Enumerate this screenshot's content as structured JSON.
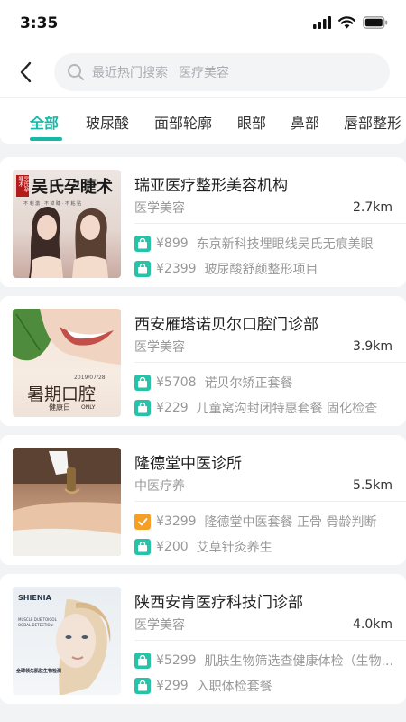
{
  "status_bar": {
    "time": "3:35"
  },
  "search": {
    "placeholder_label": "最近热门搜索",
    "placeholder_term": "医疗美容"
  },
  "tabs": [
    {
      "label": "全部",
      "active": true
    },
    {
      "label": "玻尿酸",
      "active": false
    },
    {
      "label": "面部轮廓",
      "active": false
    },
    {
      "label": "眼部",
      "active": false
    },
    {
      "label": "鼻部",
      "active": false
    },
    {
      "label": "唇部整形",
      "active": false
    }
  ],
  "accent_color": "#18b8a6",
  "clinics": [
    {
      "name": "瑞亚医疗整形美容机构",
      "category": "医学美容",
      "distance": "2.7km",
      "thumb_text": {
        "main": "吴氏孕睫术",
        "tag": "吴氏孕睫术",
        "sub": "不 刺 激 · 不 掉 睫 · 不 粘 贴"
      },
      "deals": [
        {
          "price": "¥899",
          "title": "东京新科技埋眼线吴氏无痕美眼",
          "icon": "shopping-bag-icon"
        },
        {
          "price": "¥2399",
          "title": "玻尿酸舒颜整形项目",
          "icon": "shopping-bag-icon"
        }
      ]
    },
    {
      "name": "西安雁塔诺贝尔口腔门诊部",
      "category": "医学美容",
      "distance": "3.9km",
      "thumb_text": {
        "date": "2019/07/28",
        "main": "暑期口腔",
        "sub": "健康日",
        "tag": "ONLY"
      },
      "deals": [
        {
          "price": "¥5708",
          "title": "诺贝尔矫正套餐",
          "icon": "shopping-bag-icon"
        },
        {
          "price": "¥229",
          "title": "儿童窝沟封闭特惠套餐 固化检查",
          "icon": "shopping-bag-icon"
        }
      ]
    },
    {
      "name": "隆德堂中医诊所",
      "category": "中医疗养",
      "distance": "5.5km",
      "deals": [
        {
          "price": "¥3299",
          "title": "隆德堂中医套餐 正骨 骨龄判断",
          "icon": "check-ticket-icon"
        },
        {
          "price": "¥200",
          "title": "艾草针灸养生",
          "icon": "shopping-bag-icon"
        }
      ]
    },
    {
      "name": "陕西安肯医疗科技门诊部",
      "category": "医学美容",
      "distance": "4.0km",
      "thumb_text": {
        "brand": "SHIENIA",
        "line1": "MUSCLE DUE TOIGOL",
        "line2": "OODAL DETECTION",
        "main": "全球领先肌肤生物检测"
      },
      "deals": [
        {
          "price": "¥5299",
          "title": "肌肤生物筛选查健康体检（生物...",
          "icon": "shopping-bag-icon"
        },
        {
          "price": "¥299",
          "title": "入职体检套餐",
          "icon": "shopping-bag-icon"
        }
      ]
    }
  ]
}
